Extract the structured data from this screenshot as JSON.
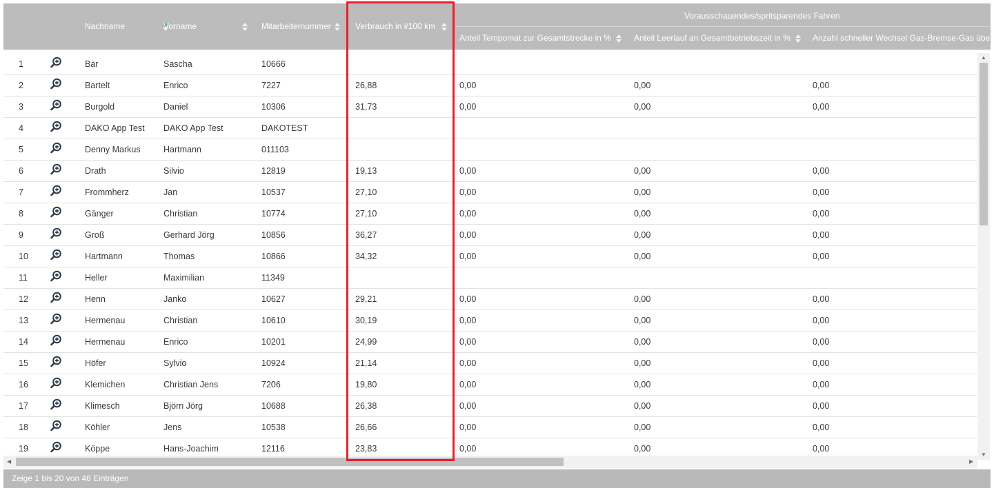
{
  "header": {
    "nachname": "Nachname",
    "vorname": "Vorname",
    "mitarbeiternummer": "Mitarbeiternummer",
    "verbrauch": "Verbrauch in l/100 km",
    "group": "Vorausschauendes/spritsparendes Fahren",
    "sub1": "Anteil Tempomat zur Gesamtstrecke in %",
    "sub2": "Anteil Leerlauf an Gesamtbetriebszeit in %",
    "sub3": "Anzahl schneller Wechsel Gas-Bremse-Gas über"
  },
  "rows": [
    {
      "nr": "1",
      "nachname": "Bär",
      "vorname": "Sascha",
      "id": "10666",
      "verbrauch": "",
      "a": "",
      "b": "",
      "c": ""
    },
    {
      "nr": "2",
      "nachname": "Bartelt",
      "vorname": "Enrico",
      "id": "7227",
      "verbrauch": "26,88",
      "a": "0,00",
      "b": "0,00",
      "c": "0,00"
    },
    {
      "nr": "3",
      "nachname": "Burgold",
      "vorname": "Daniel",
      "id": "10306",
      "verbrauch": "31,73",
      "a": "0,00",
      "b": "0,00",
      "c": "0,00"
    },
    {
      "nr": "4",
      "nachname": "DAKO App Test",
      "vorname": "DAKO App Test",
      "id": "DAKOTEST",
      "verbrauch": "",
      "a": "",
      "b": "",
      "c": ""
    },
    {
      "nr": "5",
      "nachname": "Denny Markus",
      "vorname": "Hartmann",
      "id": "011103",
      "verbrauch": "",
      "a": "",
      "b": "",
      "c": ""
    },
    {
      "nr": "6",
      "nachname": "Drath",
      "vorname": "Silvio",
      "id": "12819",
      "verbrauch": "19,13",
      "a": "0,00",
      "b": "0,00",
      "c": "0,00"
    },
    {
      "nr": "7",
      "nachname": "Frommherz",
      "vorname": "Jan",
      "id": "10537",
      "verbrauch": "27,10",
      "a": "0,00",
      "b": "0,00",
      "c": "0,00"
    },
    {
      "nr": "8",
      "nachname": "Gänger",
      "vorname": "Christian",
      "id": "10774",
      "verbrauch": "27,10",
      "a": "0,00",
      "b": "0,00",
      "c": "0,00"
    },
    {
      "nr": "9",
      "nachname": "Groß",
      "vorname": "Gerhard Jörg",
      "id": "10856",
      "verbrauch": "36,27",
      "a": "0,00",
      "b": "0,00",
      "c": "0,00"
    },
    {
      "nr": "10",
      "nachname": "Hartmann",
      "vorname": "Thomas",
      "id": "10866",
      "verbrauch": "34,32",
      "a": "0,00",
      "b": "0,00",
      "c": "0,00"
    },
    {
      "nr": "11",
      "nachname": "Heller",
      "vorname": "Maximilian",
      "id": "11349",
      "verbrauch": "",
      "a": "",
      "b": "",
      "c": ""
    },
    {
      "nr": "12",
      "nachname": "Henn",
      "vorname": "Janko",
      "id": "10627",
      "verbrauch": "29,21",
      "a": "0,00",
      "b": "0,00",
      "c": "0,00"
    },
    {
      "nr": "13",
      "nachname": "Hermenau",
      "vorname": "Christian",
      "id": "10610",
      "verbrauch": "30,19",
      "a": "0,00",
      "b": "0,00",
      "c": "0,00"
    },
    {
      "nr": "14",
      "nachname": "Hermenau",
      "vorname": "Enrico",
      "id": "10201",
      "verbrauch": "24,99",
      "a": "0,00",
      "b": "0,00",
      "c": "0,00"
    },
    {
      "nr": "15",
      "nachname": "Höfer",
      "vorname": "Sylvio",
      "id": "10924",
      "verbrauch": "21,14",
      "a": "0,00",
      "b": "0,00",
      "c": "0,00"
    },
    {
      "nr": "16",
      "nachname": "Klemichen",
      "vorname": "Christian Jens",
      "id": "7206",
      "verbrauch": "19,80",
      "a": "0,00",
      "b": "0,00",
      "c": "0,00"
    },
    {
      "nr": "17",
      "nachname": "Klimesch",
      "vorname": "Björn Jörg",
      "id": "10688",
      "verbrauch": "26,38",
      "a": "0,00",
      "b": "0,00",
      "c": "0,00"
    },
    {
      "nr": "18",
      "nachname": "Köhler",
      "vorname": "Jens",
      "id": "10538",
      "verbrauch": "26,66",
      "a": "0,00",
      "b": "0,00",
      "c": "0,00"
    },
    {
      "nr": "19",
      "nachname": "Köppe",
      "vorname": "Hans-Joachim",
      "id": "12116",
      "verbrauch": "23,83",
      "a": "0,00",
      "b": "0,00",
      "c": "0,00"
    }
  ],
  "footer": {
    "info": "Zeige 1 bis 20 von 46 Einträgen"
  },
  "icons": {
    "row_action": "zoom-in-icon",
    "sort": "sort-icon"
  },
  "colors": {
    "header_bg": "#bcbcbc",
    "highlight": "#e8202a",
    "sort_active": "#2bb3c9"
  }
}
